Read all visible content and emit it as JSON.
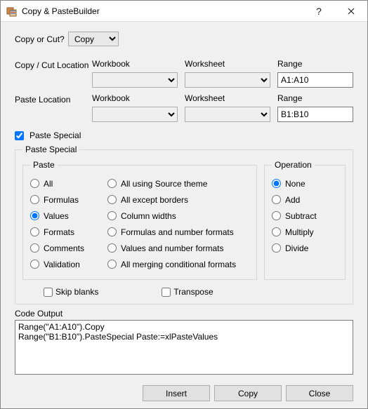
{
  "title": "Copy & PasteBuilder",
  "copycut": {
    "label": "Copy or Cut?",
    "value": "Copy"
  },
  "copyloc": {
    "title": "Copy / Cut Location",
    "workbook_label": "Workbook",
    "worksheet_label": "Worksheet",
    "range_label": "Range",
    "workbook": "",
    "worksheet": "",
    "range": "A1:A10"
  },
  "pasteloc": {
    "title": "Paste Location",
    "workbook_label": "Workbook",
    "worksheet_label": "Worksheet",
    "range_label": "Range",
    "workbook": "",
    "worksheet": "",
    "range": "B1:B10"
  },
  "paste_special_checkbox_label": "Paste Special",
  "paste_special_checked": true,
  "ps": {
    "legend": "Paste Special",
    "paste_legend": "Paste",
    "op_legend": "Operation",
    "paste_options_col1": [
      "All",
      "Formulas",
      "Values",
      "Formats",
      "Comments",
      "Validation"
    ],
    "paste_options_col2": [
      "All using Source theme",
      "All except borders",
      "Column widths",
      "Formulas and number formats",
      "Values and number formats",
      "All merging conditional formats"
    ],
    "paste_selected": "Values",
    "op_options": [
      "None",
      "Add",
      "Subtract",
      "Multiply",
      "Divide"
    ],
    "op_selected": "None",
    "skip_blanks_label": "Skip blanks",
    "transpose_label": "Transpose"
  },
  "code_output_label": "Code Output",
  "code_output": "Range(\"A1:A10\").Copy\nRange(\"B1:B10\").PasteSpecial Paste:=xlPasteValues",
  "buttons": {
    "insert": "Insert",
    "copy": "Copy",
    "close": "Close"
  }
}
